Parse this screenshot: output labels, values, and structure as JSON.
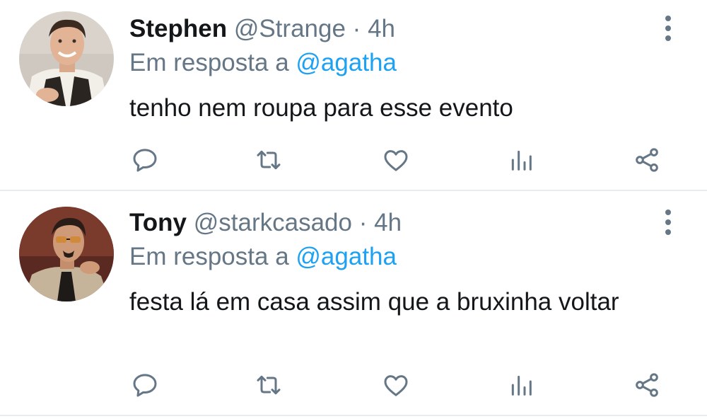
{
  "colors": {
    "text_primary": "#14171a",
    "text_secondary": "#657786",
    "mention": "#1da1f2",
    "divider": "#e6ecf0"
  },
  "tweets": [
    {
      "name": "Stephen",
      "handle": "@Strange",
      "separator": "·",
      "time": "4h",
      "reply_prefix": "Em resposta a",
      "reply_mention": "@agatha",
      "text": "tenho nem roupa para esse evento",
      "avatar_icon": "user-avatar-photo",
      "actions": [
        "reply-icon",
        "retweet-icon",
        "like-icon",
        "analytics-icon",
        "share-icon"
      ]
    },
    {
      "name": "Tony",
      "handle": "@starkcasado",
      "separator": "·",
      "time": "4h",
      "reply_prefix": "Em resposta a",
      "reply_mention": "@agatha",
      "text": "festa lá em casa assim que a bruxinha voltar",
      "avatar_icon": "user-avatar-photo",
      "actions": [
        "reply-icon",
        "retweet-icon",
        "like-icon",
        "analytics-icon",
        "share-icon"
      ]
    }
  ]
}
